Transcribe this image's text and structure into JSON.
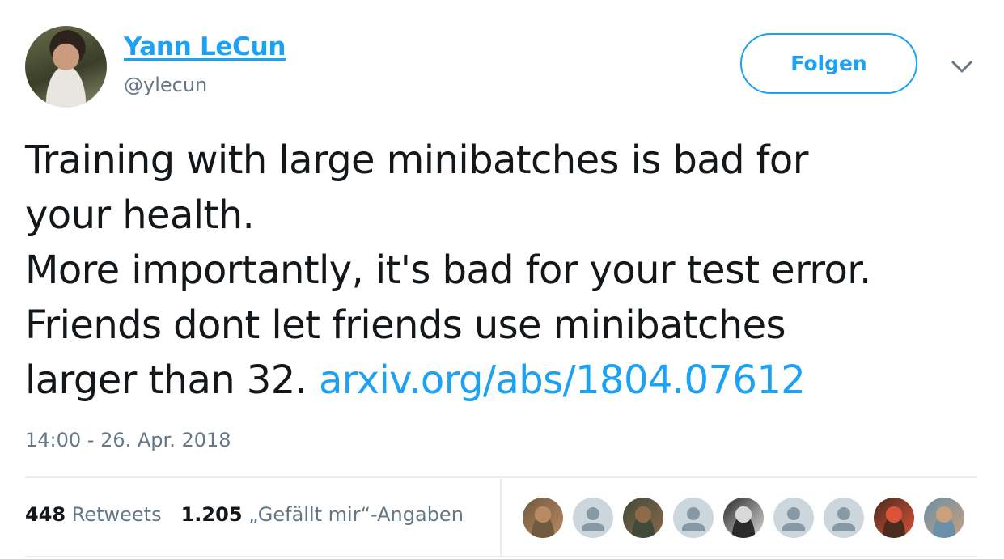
{
  "author": {
    "name": "Yann LeCun",
    "handle": "@ylecun"
  },
  "follow_button": {
    "label": "Folgen"
  },
  "menu_caret": {
    "icon": "chevron-down-icon"
  },
  "tweet": {
    "lines": [
      "Training with large minibatches is bad for",
      "your health.",
      "More importantly, it's bad for your test error.",
      "Friends dont let friends use minibatches"
    ],
    "last_line_text": "larger than 32.",
    "link": "arxiv.org/abs/1804.07612"
  },
  "timestamp": "14:00 - 26. Apr. 2018",
  "stats": {
    "retweets_count": "448",
    "retweets_label": "Retweets",
    "likes_count": "1.205",
    "likes_label": "„Gefällt mir“-Angaben"
  },
  "likers": [
    {
      "type": "photo",
      "colors": [
        "#b98a64",
        "#6f5a3f"
      ]
    },
    {
      "type": "default"
    },
    {
      "type": "photo",
      "colors": [
        "#8c6a4a",
        "#3f4a3a"
      ]
    },
    {
      "type": "default"
    },
    {
      "type": "photo",
      "colors": [
        "#d8d8d8",
        "#2b2b2b"
      ]
    },
    {
      "type": "default"
    },
    {
      "type": "default"
    },
    {
      "type": "photo",
      "colors": [
        "#d8533a",
        "#4a2b1d"
      ]
    },
    {
      "type": "photo",
      "colors": [
        "#c9a07e",
        "#6a8fa8"
      ]
    }
  ],
  "colors": {
    "accent": "#1da1f2",
    "text": "#14171a",
    "muted": "#657786",
    "divider": "#e6ecf0"
  }
}
